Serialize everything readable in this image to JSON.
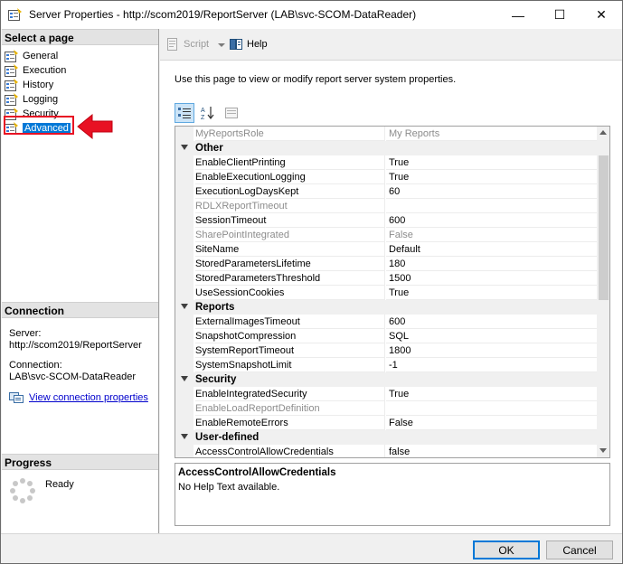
{
  "window": {
    "title": "Server Properties - http://scom2019/ReportServer (LAB\\svc-SCOM-DataReader)",
    "minimize": "—",
    "maximize": "☐",
    "close": "✕"
  },
  "left": {
    "select_page_header": "Select a page",
    "pages": [
      {
        "label": "General",
        "selected": false
      },
      {
        "label": "Execution",
        "selected": false
      },
      {
        "label": "History",
        "selected": false
      },
      {
        "label": "Logging",
        "selected": false
      },
      {
        "label": "Security",
        "selected": false
      },
      {
        "label": "Advanced",
        "selected": true
      }
    ],
    "connection_header": "Connection",
    "server_label": "Server:",
    "server_value": "http://scom2019/ReportServer",
    "connection_label": "Connection:",
    "connection_value": "LAB\\svc-SCOM-DataReader",
    "view_connection_link": "View connection properties",
    "progress_header": "Progress",
    "progress_status": "Ready"
  },
  "toolbar": {
    "script_label": "Script",
    "help_label": "Help"
  },
  "main": {
    "description": "Use this page to view or modify report server system properties.",
    "grid": {
      "rows": [
        {
          "kind": "prop",
          "name": "MyReportsRole",
          "value": "My Reports",
          "disabled": true
        },
        {
          "kind": "cat",
          "name": "Other"
        },
        {
          "kind": "prop",
          "name": "EnableClientPrinting",
          "value": "True",
          "disabled": false
        },
        {
          "kind": "prop",
          "name": "EnableExecutionLogging",
          "value": "True",
          "disabled": false
        },
        {
          "kind": "prop",
          "name": "ExecutionLogDaysKept",
          "value": "60",
          "disabled": false
        },
        {
          "kind": "prop",
          "name": "RDLXReportTimeout",
          "value": "",
          "disabled": true
        },
        {
          "kind": "prop",
          "name": "SessionTimeout",
          "value": "600",
          "disabled": false
        },
        {
          "kind": "prop",
          "name": "SharePointIntegrated",
          "value": "False",
          "disabled": true
        },
        {
          "kind": "prop",
          "name": "SiteName",
          "value": "Default",
          "disabled": false
        },
        {
          "kind": "prop",
          "name": "StoredParametersLifetime",
          "value": "180",
          "disabled": false
        },
        {
          "kind": "prop",
          "name": "StoredParametersThreshold",
          "value": "1500",
          "disabled": false
        },
        {
          "kind": "prop",
          "name": "UseSessionCookies",
          "value": "True",
          "disabled": false
        },
        {
          "kind": "cat",
          "name": "Reports"
        },
        {
          "kind": "prop",
          "name": "ExternalImagesTimeout",
          "value": "600",
          "disabled": false
        },
        {
          "kind": "prop",
          "name": "SnapshotCompression",
          "value": "SQL",
          "disabled": false
        },
        {
          "kind": "prop",
          "name": "SystemReportTimeout",
          "value": "1800",
          "disabled": false
        },
        {
          "kind": "prop",
          "name": "SystemSnapshotLimit",
          "value": "-1",
          "disabled": false
        },
        {
          "kind": "cat",
          "name": "Security"
        },
        {
          "kind": "prop",
          "name": "EnableIntegratedSecurity",
          "value": "True",
          "disabled": false
        },
        {
          "kind": "prop",
          "name": "EnableLoadReportDefinition",
          "value": "",
          "disabled": true
        },
        {
          "kind": "prop",
          "name": "EnableRemoteErrors",
          "value": "False",
          "disabled": false
        },
        {
          "kind": "cat",
          "name": "User-defined"
        },
        {
          "kind": "prop",
          "name": "AccessControlAllowCredentials",
          "value": "false",
          "disabled": false
        }
      ]
    },
    "help": {
      "title": "AccessControlAllowCredentials",
      "text": "No Help Text available."
    }
  },
  "footer": {
    "ok_label": "OK",
    "cancel_label": "Cancel"
  },
  "colors": {
    "selection": "#0078d7",
    "highlight_frame": "#e81123",
    "link": "#0000cc"
  }
}
